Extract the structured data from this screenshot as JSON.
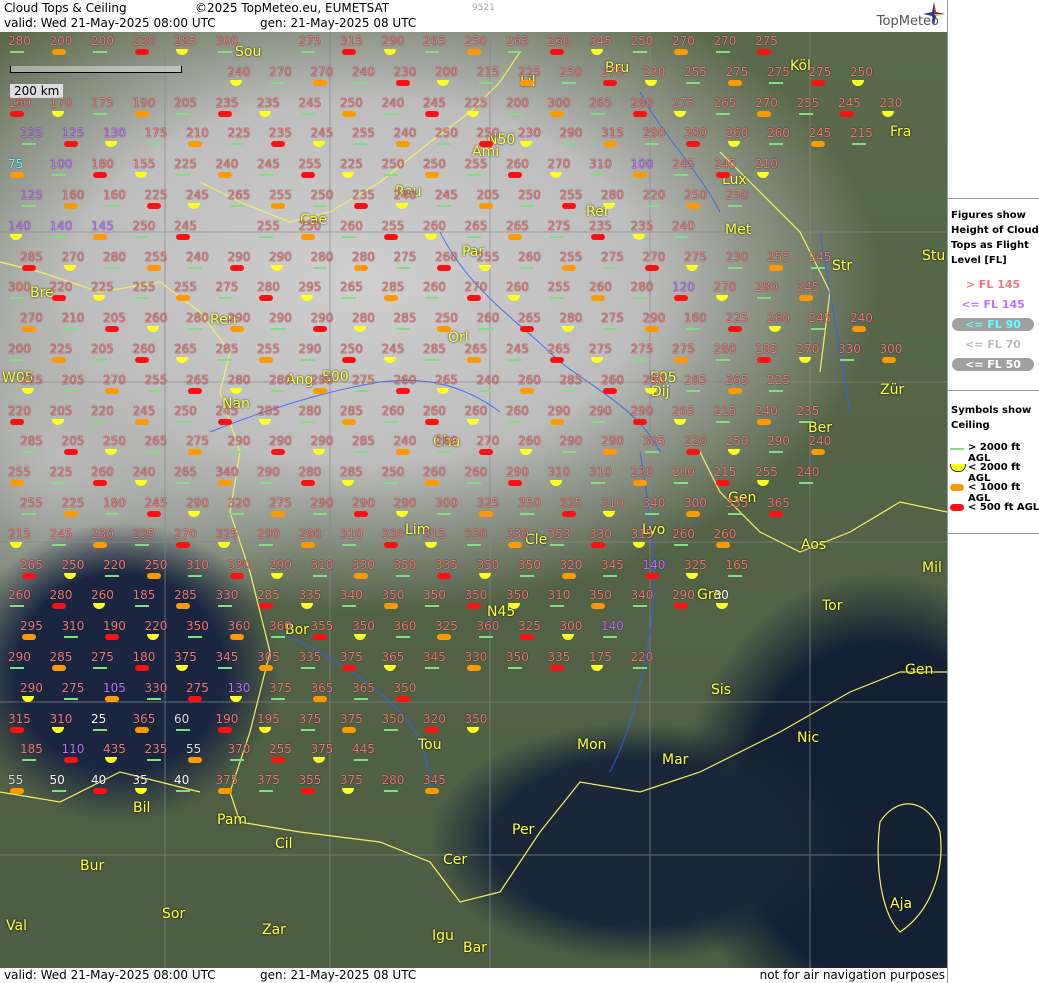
{
  "header": {
    "title": "Cloud Tops & Ceiling",
    "copyright": "©2025 TopMeteo.eu, EUMETSAT",
    "valid": "valid:  Wed  21-May-2025  08:00 UTC",
    "gen": "gen: 21-May-2025 08 UTC",
    "code": "9521",
    "logo": "TopMeteo"
  },
  "scale_label": "200 km",
  "footer": {
    "valid": "valid:  Wed  21-May-2025  08:00 UTC",
    "gen": "gen: 21-May-2025 08 UTC",
    "disclaimer": "not for air navigation purposes"
  },
  "legend": {
    "title": "Figures show Height of Cloud Tops as Flight Level  [FL]",
    "items": [
      {
        "label": "> FL 145",
        "color": "#f07878"
      },
      {
        "label": "<= FL 145",
        "color": "#c070ff"
      },
      {
        "label": "<= FL 90",
        "color": "#60ffff"
      },
      {
        "label": "<= FL 70",
        "color": "#bbbbbb"
      },
      {
        "label": "<= FL 50",
        "color": "#ffffff"
      }
    ],
    "symbols_title": "Symbols show Ceiling",
    "symbols": [
      {
        "label": "> 2000 ft AGL",
        "kind": "line",
        "color": "#80e080"
      },
      {
        "label": "< 2000 ft AGL",
        "kind": "half",
        "color": "#ffff20"
      },
      {
        "label": "< 1000 ft AGL",
        "kind": "pill",
        "color": "#ff9900"
      },
      {
        "label": "< 500 ft AGL",
        "kind": "pill",
        "color": "#ff1010"
      }
    ]
  },
  "cities": [
    "Sou",
    "Bru",
    "Köl",
    "Lil",
    "Ami",
    "N50",
    "Fra",
    "Lux",
    "Rou",
    "Rei",
    "Cae",
    "Met",
    "Par",
    "Str",
    "Stu",
    "Bre",
    "Ren",
    "Orl",
    "W05",
    "E00",
    "E05",
    "Dij",
    "Zür",
    "Ang",
    "Nan",
    "Ber",
    "Cha",
    "Gen",
    "Lim",
    "Cle",
    "Lyo",
    "Aos",
    "Mil",
    "N45",
    "Tor",
    "Gre",
    "Bor",
    "Gen",
    "Sis",
    "Nic",
    "Tou",
    "Mon",
    "Mar",
    "Bil",
    "Pam",
    "Cil",
    "Per",
    "Bur",
    "Cer",
    "Sor",
    "Ajа",
    "Val",
    "Zar",
    "Igu",
    "Bar"
  ],
  "map_values": [
    {
      "row": 0,
      "values": [
        "280",
        "200",
        "200",
        "230",
        "285",
        "300",
        "",
        "275",
        "315",
        "290",
        "265",
        "250",
        "265",
        "260",
        "345",
        "250",
        "270",
        "270",
        "275"
      ]
    },
    {
      "row": 1,
      "values": [
        "",
        "",
        "",
        "",
        "",
        "240",
        "270",
        "270",
        "240",
        "230",
        "200",
        "215",
        "225",
        "250",
        "275",
        "230",
        "255",
        "275",
        "275",
        "275",
        "250"
      ]
    },
    {
      "row": 2,
      "values": [
        "160",
        "170",
        "175",
        "190",
        "205",
        "235",
        "235",
        "245",
        "250",
        "240",
        "245",
        "225",
        "200",
        "300",
        "265",
        "280",
        "275",
        "265",
        "270",
        "255",
        "245",
        "230"
      ]
    },
    {
      "row": 3,
      "values": [
        "125",
        "125",
        "130",
        "175",
        "210",
        "225",
        "235",
        "245",
        "255",
        "240",
        "250",
        "250",
        "230",
        "290",
        "315",
        "290",
        "300",
        "260",
        "260",
        "245",
        "215"
      ]
    },
    {
      "row": 4,
      "values": [
        "75",
        "100",
        "180",
        "155",
        "225",
        "240",
        "245",
        "255",
        "225",
        "250",
        "250",
        "255",
        "260",
        "270",
        "310",
        "100",
        "245",
        "245",
        "210"
      ]
    },
    {
      "row": 5,
      "values": [
        "125",
        "160",
        "160",
        "225",
        "245",
        "265",
        "255",
        "250",
        "235",
        "240",
        "245",
        "205",
        "250",
        "255",
        "280",
        "220",
        "250",
        "250"
      ]
    },
    {
      "row": 6,
      "values": [
        "140",
        "140",
        "145",
        "250",
        "245",
        "",
        "255",
        "250",
        "260",
        "255",
        "260",
        "265",
        "265",
        "275",
        "235",
        "235",
        "240"
      ]
    },
    {
      "row": 7,
      "values": [
        "285",
        "270",
        "280",
        "255",
        "240",
        "290",
        "290",
        "280",
        "280",
        "275",
        "260",
        "255",
        "260",
        "255",
        "275",
        "270",
        "275",
        "230",
        "255",
        "245"
      ]
    },
    {
      "row": 8,
      "values": [
        "300",
        "220",
        "225",
        "255",
        "255",
        "275",
        "280",
        "295",
        "265",
        "285",
        "260",
        "270",
        "260",
        "255",
        "260",
        "280",
        "120",
        "270",
        "280",
        "245"
      ]
    },
    {
      "row": 9,
      "values": [
        "270",
        "210",
        "205",
        "260",
        "280",
        "290",
        "290",
        "290",
        "280",
        "285",
        "250",
        "260",
        "265",
        "280",
        "275",
        "290",
        "160",
        "225",
        "260",
        "245",
        "240"
      ]
    },
    {
      "row": 10,
      "values": [
        "200",
        "225",
        "205",
        "260",
        "265",
        "285",
        "255",
        "290",
        "250",
        "245",
        "285",
        "265",
        "245",
        "265",
        "275",
        "275",
        "275",
        "280",
        "185",
        "270",
        "330",
        "300"
      ]
    },
    {
      "row": 11,
      "values": [
        "225",
        "205",
        "270",
        "255",
        "265",
        "280",
        "280",
        "290",
        "275",
        "260",
        "265",
        "240",
        "260",
        "285",
        "260",
        "290",
        "285",
        "265",
        "225"
      ]
    },
    {
      "row": 12,
      "values": [
        "220",
        "205",
        "220",
        "245",
        "250",
        "245",
        "285",
        "280",
        "285",
        "260",
        "260",
        "260",
        "260",
        "290",
        "290",
        "290",
        "265",
        "215",
        "240",
        "235"
      ]
    },
    {
      "row": 13,
      "values": [
        "285",
        "205",
        "250",
        "265",
        "275",
        "290",
        "290",
        "290",
        "285",
        "240",
        "260",
        "270",
        "260",
        "290",
        "290",
        "305",
        "220",
        "250",
        "290",
        "240"
      ]
    },
    {
      "row": 14,
      "values": [
        "255",
        "225",
        "260",
        "240",
        "265",
        "340",
        "290",
        "280",
        "285",
        "250",
        "260",
        "260",
        "290",
        "310",
        "310",
        "230",
        "200",
        "215",
        "255",
        "240"
      ]
    },
    {
      "row": 15,
      "values": [
        "255",
        "225",
        "180",
        "245",
        "290",
        "320",
        "275",
        "290",
        "290",
        "290",
        "300",
        "325",
        "350",
        "335",
        "310",
        "340",
        "300",
        "335",
        "365"
      ]
    },
    {
      "row": 16,
      "values": [
        "215",
        "245",
        "230",
        "235",
        "270",
        "325",
        "290",
        "290",
        "310",
        "330",
        "315",
        "330",
        "330",
        "353",
        "330",
        "315",
        "260",
        "260"
      ]
    },
    {
      "row": 17,
      "values": [
        "265",
        "250",
        "220",
        "250",
        "310",
        "330",
        "290",
        "310",
        "330",
        "350",
        "335",
        "350",
        "350",
        "320",
        "345",
        "140",
        "325",
        "165"
      ]
    },
    {
      "row": 18,
      "values": [
        "260",
        "280",
        "260",
        "185",
        "285",
        "330",
        "285",
        "335",
        "340",
        "350",
        "350",
        "350",
        "350",
        "310",
        "350",
        "340",
        "290",
        "30"
      ]
    },
    {
      "row": 19,
      "values": [
        "295",
        "310",
        "190",
        "220",
        "350",
        "360",
        "360",
        "355",
        "350",
        "360",
        "325",
        "360",
        "325",
        "300",
        "140"
      ]
    },
    {
      "row": 20,
      "values": [
        "290",
        "285",
        "275",
        "180",
        "375",
        "345",
        "305",
        "335",
        "375",
        "365",
        "345",
        "330",
        "350",
        "335",
        "175",
        "220"
      ]
    },
    {
      "row": 21,
      "values": [
        "290",
        "275",
        "105",
        "330",
        "275",
        "130",
        "375",
        "365",
        "365",
        "350"
      ]
    },
    {
      "row": 22,
      "values": [
        "315",
        "310",
        "25",
        "365",
        "60",
        "190",
        "195",
        "375",
        "375",
        "350",
        "320",
        "350"
      ]
    },
    {
      "row": 23,
      "values": [
        "185",
        "110",
        "435",
        "235",
        "55",
        "370",
        "255",
        "375",
        "445"
      ]
    },
    {
      "row": 24,
      "values": [
        "55",
        "50",
        "40",
        "35",
        "40",
        "375",
        "375",
        "355",
        "375",
        "280",
        "345"
      ]
    }
  ]
}
